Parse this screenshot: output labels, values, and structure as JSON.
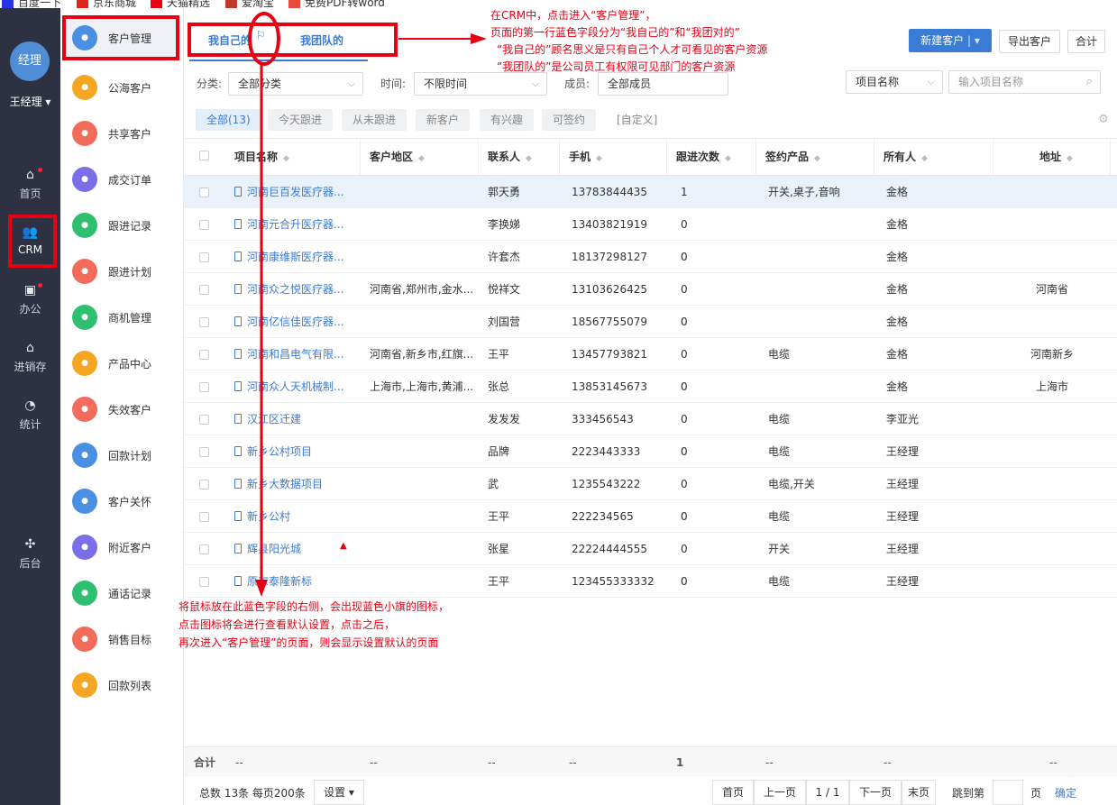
{
  "bookmarks": [
    {
      "label": "百度一下",
      "icon": "baidu-icon",
      "color": "#2932e1",
      "badge": "百"
    },
    {
      "label": "京东商城",
      "icon": "jd-icon",
      "color": "#e1251b",
      "badge": "JD"
    },
    {
      "label": "天猫精选",
      "icon": "tmall-icon",
      "color": "#e60012",
      "badge": "T"
    },
    {
      "label": "爱淘宝",
      "icon": "aitaobao-icon",
      "color": "#c0392b",
      "badge": "淘"
    },
    {
      "label": "免费PDF转word",
      "icon": "pdf-icon",
      "color": "#e84a3b",
      "badge": "P"
    }
  ],
  "user": {
    "avatar_text": "经理",
    "name": "王经理 ▾"
  },
  "nav": {
    "items": [
      {
        "label": "首页",
        "icon": "home-icon",
        "glyph": "⌂",
        "dot": true
      },
      {
        "label": "CRM",
        "icon": "crm-users-icon",
        "glyph": "👥",
        "dot": false
      },
      {
        "label": "办公",
        "icon": "briefcase-icon",
        "glyph": "▣",
        "dot": true
      },
      {
        "label": "进销存",
        "icon": "inventory-icon",
        "glyph": "⌂",
        "dot": false
      },
      {
        "label": "统计",
        "icon": "pie-chart-icon",
        "glyph": "◔",
        "dot": false
      },
      {
        "label": "后台",
        "icon": "settings-grid-icon",
        "glyph": "✣",
        "dot": false
      }
    ]
  },
  "menu2": [
    {
      "label": "客户管理",
      "icon": "customer-manage-icon",
      "color": "#4b8fe2"
    },
    {
      "label": "公海客户",
      "icon": "sea-customer-icon",
      "color": "#f5a623"
    },
    {
      "label": "共享客户",
      "icon": "shared-customer-icon",
      "color": "#f26b5b"
    },
    {
      "label": "成交订单",
      "icon": "order-icon",
      "color": "#7b6fe8"
    },
    {
      "label": "跟进记录",
      "icon": "followup-record-icon",
      "color": "#2fbf71"
    },
    {
      "label": "跟进计划",
      "icon": "followup-plan-icon",
      "color": "#f26b5b"
    },
    {
      "label": "商机管理",
      "icon": "opportunity-icon",
      "color": "#2fbf71"
    },
    {
      "label": "产品中心",
      "icon": "product-icon",
      "color": "#f5a623"
    },
    {
      "label": "失效客户",
      "icon": "invalid-customer-icon",
      "color": "#f26b5b"
    },
    {
      "label": "回款计划",
      "icon": "payment-plan-icon",
      "color": "#4b8fe2"
    },
    {
      "label": "客户关怀",
      "icon": "customer-care-icon",
      "color": "#4b8fe2"
    },
    {
      "label": "附近客户",
      "icon": "nearby-customer-icon",
      "color": "#7b6fe8"
    },
    {
      "label": "通话记录",
      "icon": "call-record-icon",
      "color": "#2fbf71"
    },
    {
      "label": "销售目标",
      "icon": "sales-target-icon",
      "color": "#f26b5b"
    },
    {
      "label": "回款列表",
      "icon": "payment-list-icon",
      "color": "#f5a623"
    }
  ],
  "tabs": {
    "mine": "我自己的",
    "team": "我团队的"
  },
  "toolbar": {
    "new_customer": "新建客户",
    "export": "导出客户",
    "total": "合计"
  },
  "filters": {
    "category_label": "分类:",
    "category_value": "全部分类",
    "time_label": "时间:",
    "time_value": "不限时间",
    "member_label": "成员:",
    "member_value": "全部成员",
    "project_select": "项目名称",
    "project_placeholder": "输入项目名称"
  },
  "quick_filters": [
    "全部(13)",
    "今天跟进",
    "从未跟进",
    "新客户",
    "有兴趣",
    "可签约",
    "[自定义]"
  ],
  "columns": [
    "项目名称",
    "客户地区",
    "联系人",
    "手机",
    "跟进次数",
    "签约产品",
    "所有人",
    "地址"
  ],
  "rows": [
    {
      "name": "河南巨百发医疗器...",
      "region": "",
      "contact": "郭天勇",
      "phone": "13783844435",
      "follow": "1",
      "product": "开关,桌子,音响",
      "owner": "金格",
      "address": ""
    },
    {
      "name": "河南元合升医疗器...",
      "region": "",
      "contact": "李换娣",
      "phone": "13403821919",
      "follow": "0",
      "product": "",
      "owner": "金格",
      "address": ""
    },
    {
      "name": "河南康维斯医疗器...",
      "region": "",
      "contact": "许套杰",
      "phone": "18137298127",
      "follow": "0",
      "product": "",
      "owner": "金格",
      "address": ""
    },
    {
      "name": "河南众之悦医疗器...",
      "region": "河南省,郑州市,金水...",
      "contact": "悦祥文",
      "phone": "13103626425",
      "follow": "0",
      "product": "",
      "owner": "金格",
      "address": "河南省"
    },
    {
      "name": "河南亿信佳医疗器...",
      "region": "",
      "contact": "刘国营",
      "phone": "18567755079",
      "follow": "0",
      "product": "",
      "owner": "金格",
      "address": ""
    },
    {
      "name": "河南和昌电气有限...",
      "region": "河南省,新乡市,红旗...",
      "contact": "王平",
      "phone": "13457793821",
      "follow": "0",
      "product": "电缆",
      "owner": "金格",
      "address": "河南新乡"
    },
    {
      "name": "河南众人天机械制...",
      "region": "上海市,上海市,黄浦...",
      "contact": "张总",
      "phone": "13853145673",
      "follow": "0",
      "product": "",
      "owner": "金格",
      "address": "上海市"
    },
    {
      "name": "汉江区迁建",
      "region": "",
      "contact": "发发发",
      "phone": "333456543",
      "follow": "0",
      "product": "电缆",
      "owner": "李亚光",
      "address": ""
    },
    {
      "name": "新乡公村项目",
      "region": "",
      "contact": "品牌",
      "phone": "2223443333",
      "follow": "0",
      "product": "电缆",
      "owner": "王经理",
      "address": ""
    },
    {
      "name": "新乡大数据项目",
      "region": "",
      "contact": "武",
      "phone": "1235543222",
      "follow": "0",
      "product": "电缆,开关",
      "owner": "王经理",
      "address": ""
    },
    {
      "name": "新乡公村",
      "region": "",
      "contact": "王平",
      "phone": "222234565",
      "follow": "0",
      "product": "电缆",
      "owner": "王经理",
      "address": ""
    },
    {
      "name": "辉县阳光城",
      "region": "",
      "contact": "张星",
      "phone": "22224444555",
      "follow": "0",
      "product": "开关",
      "owner": "王经理",
      "address": ""
    },
    {
      "name": "原东泰隆新标",
      "region": "",
      "contact": "王平",
      "phone": "123455333332",
      "follow": "0",
      "product": "电缆",
      "owner": "王经理",
      "address": ""
    }
  ],
  "summary": {
    "label": "合计",
    "dash": "--",
    "follow_total": "1"
  },
  "pager": {
    "info": "总数 13条 每页200条",
    "settings": "设置 ▾",
    "first": "首页",
    "prev": "上一页",
    "page": "1 / 1",
    "next": "下一页",
    "last": "末页",
    "jump": "跳到第",
    "page_unit": "页",
    "confirm": "确定"
  },
  "annotations": {
    "top": [
      "在CRM中，点击进入“客户管理”，",
      "页面的第一行蓝色字段分为“我自己的”和“我团对的”",
      "“我自己的”顾名思义是只有自己个人才可看见的客户资源",
      "“我团队的”是公司员工有权限可见部门的客户资源"
    ],
    "bottom": [
      "将鼠标放在此蓝色字段的右侧，会出现蓝色小旗的图标，",
      "点击图标将会进行查看默认设置，点击之后，",
      "再次进入“客户管理”的页面，则会显示设置默认的页面"
    ]
  },
  "colors": {
    "accent": "#3a7bd5",
    "annotation": "#e60012",
    "nav_bg": "#2d3142"
  }
}
